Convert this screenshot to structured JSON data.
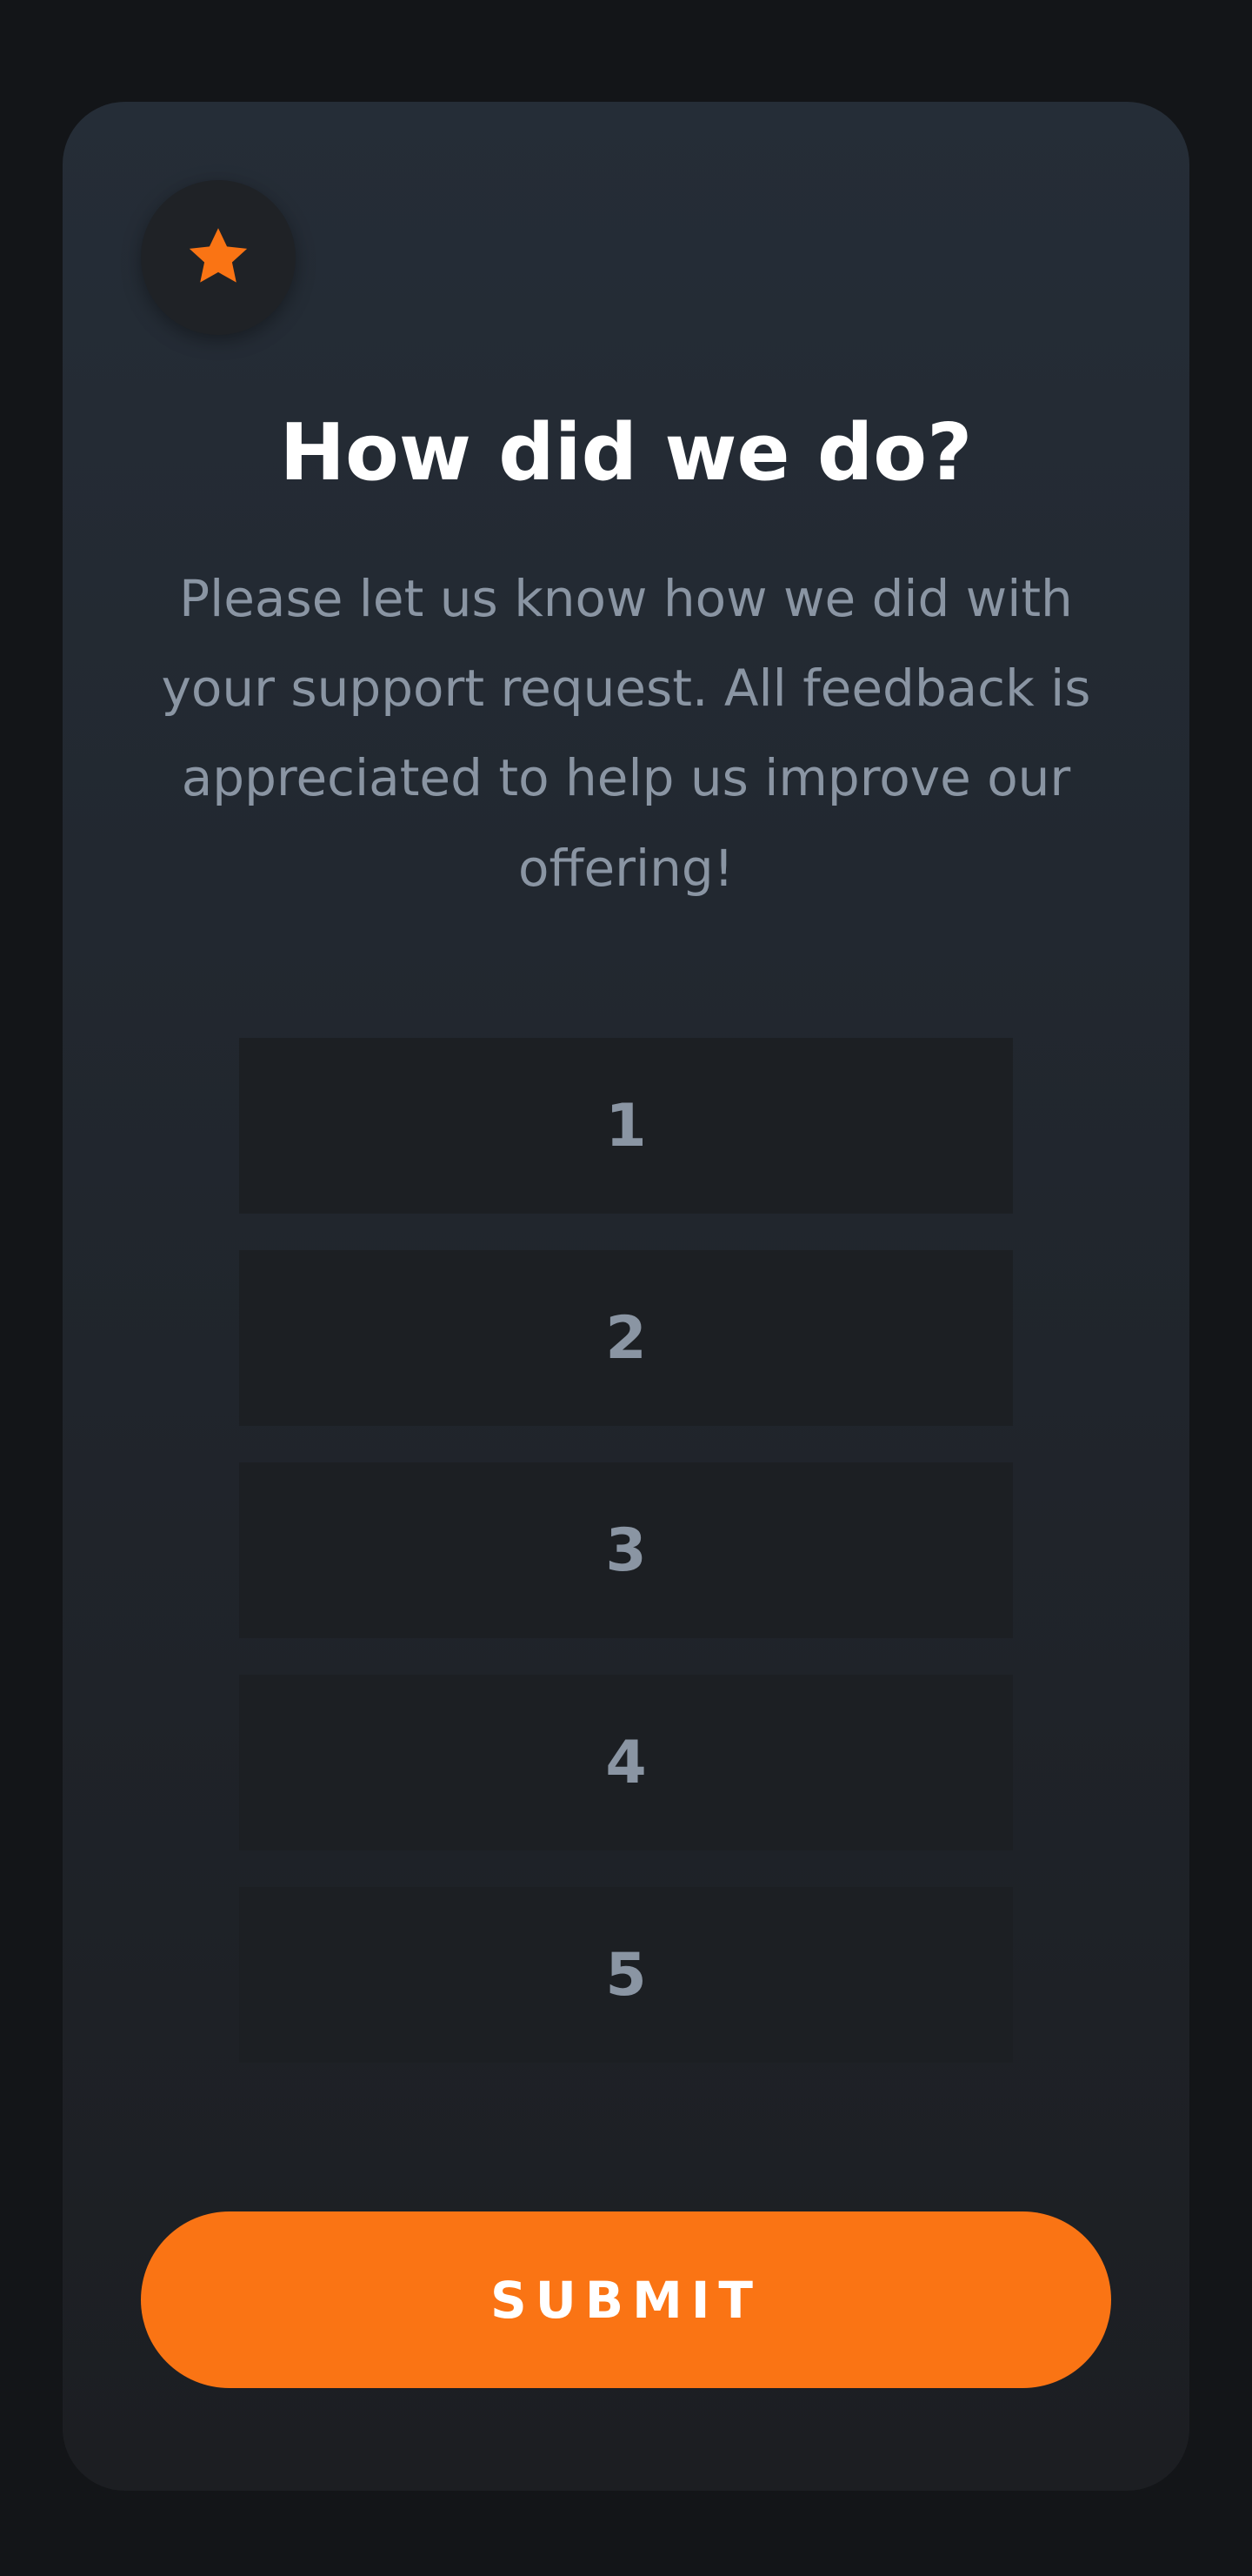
{
  "card": {
    "title": "How did we do?",
    "description": "Please let us know how we did with your support request. All feedback is appreciated to help us improve our offering!",
    "icon": "star-icon"
  },
  "ratings": [
    {
      "label": "1"
    },
    {
      "label": "2"
    },
    {
      "label": "3"
    },
    {
      "label": "4"
    },
    {
      "label": "5"
    }
  ],
  "submit_label": "SUBMIT",
  "colors": {
    "accent": "#fa7414",
    "background": "#131518",
    "card_top": "#252d37",
    "card_bottom": "#1c1e22",
    "muted_text": "#8a95a3",
    "rating_bg": "#1c1f23"
  }
}
